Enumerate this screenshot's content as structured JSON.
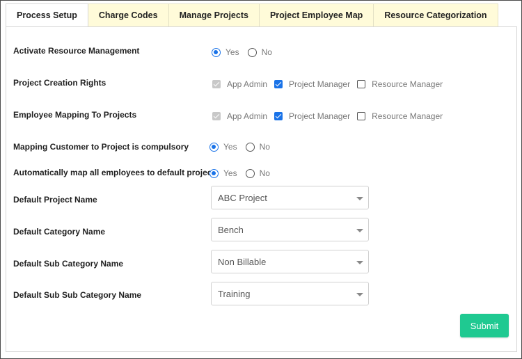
{
  "tabs": [
    {
      "label": "Process Setup",
      "active": true
    },
    {
      "label": "Charge Codes",
      "active": false
    },
    {
      "label": "Manage Projects",
      "active": false
    },
    {
      "label": "Project Employee Map",
      "active": false
    },
    {
      "label": "Resource Categorization",
      "active": false
    }
  ],
  "settings": {
    "activate_resource": {
      "label": "Activate Resource Management",
      "yes": "Yes",
      "no": "No",
      "selected": "Yes"
    },
    "project_creation": {
      "label": "Project Creation Rights",
      "app_admin": "App Admin",
      "project_manager": "Project Manager",
      "resource_manager": "Resource Manager"
    },
    "employee_mapping": {
      "label": "Employee Mapping To Projects",
      "app_admin": "App Admin",
      "project_manager": "Project Manager",
      "resource_manager": "Resource Manager"
    },
    "mapping_customer": {
      "label": "Mapping Customer to Project is compulsory",
      "yes": "Yes",
      "no": "No",
      "selected": "Yes"
    },
    "auto_map": {
      "label": "Automatically map all employees to default project",
      "yes": "Yes",
      "no": "No",
      "selected": "Yes"
    },
    "default_project": {
      "label": "Default Project Name",
      "value": "ABC Project"
    },
    "default_category": {
      "label": "Default Category Name",
      "value": "Bench"
    },
    "default_sub_category": {
      "label": "Default Sub Category Name",
      "value": "Non Billable"
    },
    "default_sub_sub_category": {
      "label": "Default Sub Sub Category Name",
      "value": "Training"
    }
  },
  "submit_label": "Submit",
  "colors": {
    "accent": "#1a73e8",
    "submit": "#1fc991",
    "tab_inactive": "#fffbd9"
  }
}
